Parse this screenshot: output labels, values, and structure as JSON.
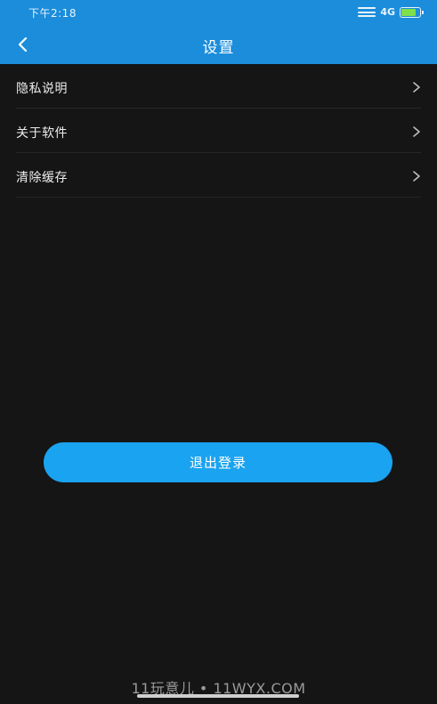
{
  "status_bar": {
    "time": "下午2:18",
    "network": "4G",
    "battery_level": 0.8
  },
  "nav": {
    "title": "设置"
  },
  "settings": {
    "items": [
      {
        "label": "隐私说明"
      },
      {
        "label": "关于软件"
      },
      {
        "label": "清除缓存"
      }
    ]
  },
  "actions": {
    "logout_label": "退出登录"
  },
  "watermark": {
    "text": "11玩意儿 • 11WYX.COM"
  },
  "colors": {
    "header_bg": "#1b8ddb",
    "page_bg": "#151515",
    "button_bg": "#1aa3f0",
    "divider": "#262626"
  }
}
